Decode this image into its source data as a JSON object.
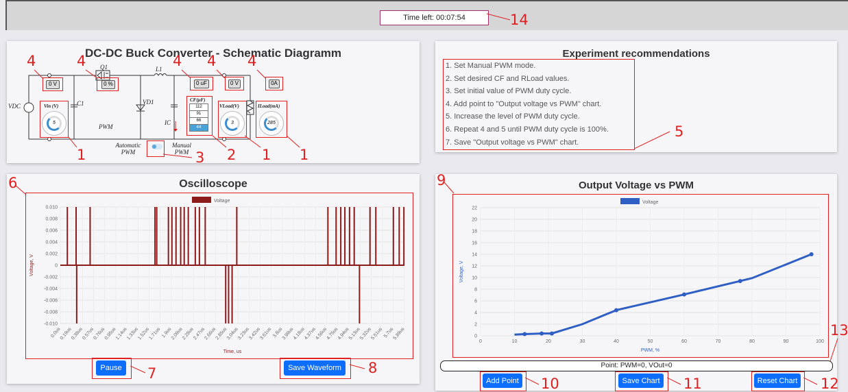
{
  "timer": {
    "text": "Time left: 00:07:54"
  },
  "annotations": {
    "a1": "1",
    "a2": "2",
    "a3": "3",
    "a4": "4",
    "a5": "5",
    "a6": "6",
    "a7": "7",
    "a8": "8",
    "a9": "9",
    "a10": "10",
    "a11": "11",
    "a12": "12",
    "a13": "13",
    "a14": "14"
  },
  "schematic": {
    "title": "DC-DC Buck Converter - Schematic Diagramm",
    "vdc": "VDC",
    "q1": "Q1",
    "l1": "L1",
    "c1": "C1",
    "vd1": "VD1",
    "pwm": "PWM",
    "ic": "IC",
    "vin_readout": "0 V",
    "pwm_readout": "0 %",
    "cf_readout": "0 uF",
    "vout_readout": "0 V",
    "iload_readout": "0A",
    "vin_knob_label": "Vin (V)",
    "vin_knob_value": "5",
    "vload_knob_label": "VLoad(V)",
    "vload_knob_value": "3",
    "iload_knob_label": "ILoad(mA)",
    "iload_knob_value": "285",
    "cf_label": "CF(μF)",
    "cf_options": [
      "112",
      "91",
      "66",
      "44"
    ],
    "cf_selected": "44",
    "auto_pwm": "Automatic PWM",
    "manual_pwm": "Manual PWM"
  },
  "recommendations": {
    "title": "Experiment recommendations",
    "items": [
      "1. Set Manual PWM mode.",
      "2. Set desired CF and RLoad values.",
      "3. Set initial value of PWM duty cycle.",
      "4. Add point to \"Output voltage vs PWM\" chart.",
      "5. Increase the level of PWM duty cycle.",
      "6. Repeat 4 and 5 until PWM duty cycle is 100%.",
      "7. Save \"Output voltage vs PWM\" chart."
    ]
  },
  "oscilloscope": {
    "title": "Oscilloscope",
    "pause_label": "Pause",
    "save_label": "Save Waveform"
  },
  "vpwm": {
    "title": "Output Voltage vs PWM",
    "point_text": "Point: PWM=0, VOut=0",
    "add_label": "Add Point",
    "save_label": "Save Chart",
    "reset_label": "Reset Chart"
  },
  "colors": {
    "osc_series": "#8b1a1a",
    "vpwm_series": "#2f5fc4",
    "button": "#0d6efd",
    "annotation": "#e02020"
  },
  "chart_data": [
    {
      "type": "line",
      "title": "",
      "legend": [
        "Voltage"
      ],
      "xlabel": "Time, us",
      "ylabel": "Voltage, V",
      "ylim": [
        -0.01,
        0.01
      ],
      "yticks": [
        "0.010",
        "0.008",
        "0.006",
        "0.004",
        "0.002",
        "0",
        "-0.002",
        "-0.004",
        "-0.006",
        "-0.008",
        "-0.010"
      ],
      "xticks": [
        "0.0us",
        "0.19us",
        "0.38us",
        "0.57us",
        "0.76us",
        "0.95us",
        "1.14us",
        "1.33us",
        "1.52us",
        "1.71us",
        "1.9us",
        "2.09us",
        "2.28us",
        "2.47us",
        "2.66us",
        "2.85us",
        "3.04us",
        "3.23us",
        "3.42us",
        "3.61us",
        "3.8us",
        "3.99us",
        "4.18us",
        "4.37us",
        "4.56us",
        "4.75us",
        "4.94us",
        "5.13us",
        "5.32us",
        "5.51us",
        "5.7us",
        "5.89us"
      ],
      "series": [
        {
          "name": "Voltage",
          "spikes": [
            {
              "t": 0.12,
              "v": 0.01
            },
            {
              "t": 0.27,
              "v": 0.01
            },
            {
              "t": 0.28,
              "v": -0.01
            },
            {
              "t": 0.51,
              "v": 0.01
            },
            {
              "t": 1.62,
              "v": 0.01
            },
            {
              "t": 1.65,
              "v": 0.01
            },
            {
              "t": 1.85,
              "v": 0.01
            },
            {
              "t": 1.91,
              "v": 0.01
            },
            {
              "t": 1.98,
              "v": 0.01
            },
            {
              "t": 2.06,
              "v": 0.01
            },
            {
              "t": 2.12,
              "v": 0.01
            },
            {
              "t": 2.19,
              "v": 0.01
            },
            {
              "t": 2.31,
              "v": 0.01
            },
            {
              "t": 2.38,
              "v": 0.01
            },
            {
              "t": 2.48,
              "v": 0.01
            },
            {
              "t": 2.83,
              "v": -0.01
            },
            {
              "t": 2.88,
              "v": -0.01
            },
            {
              "t": 2.94,
              "v": -0.01
            },
            {
              "t": 3.02,
              "v": 0.01
            },
            {
              "t": 4.58,
              "v": 0.01
            },
            {
              "t": 4.72,
              "v": 0.01
            },
            {
              "t": 4.8,
              "v": 0.01
            },
            {
              "t": 4.87,
              "v": 0.01
            },
            {
              "t": 4.95,
              "v": 0.01
            },
            {
              "t": 5.03,
              "v": 0.01
            },
            {
              "t": 5.12,
              "v": -0.01
            },
            {
              "t": 5.3,
              "v": 0.01
            },
            {
              "t": 5.4,
              "v": 0.01
            },
            {
              "t": 5.7,
              "v": 0.01
            },
            {
              "t": 5.8,
              "v": 0.01
            },
            {
              "t": 5.88,
              "v": 0.01
            }
          ]
        }
      ]
    },
    {
      "type": "line",
      "title": "Output Voltage vs PWM",
      "legend": [
        "Voltage"
      ],
      "xlabel": "PWM, %",
      "ylabel": "Voltage, V",
      "xlim": [
        0,
        100
      ],
      "ylim": [
        0,
        22
      ],
      "series": [
        {
          "name": "Voltage",
          "x": [
            10,
            13,
            18,
            21,
            30,
            40,
            60,
            76.5,
            80,
            97.5
          ],
          "y": [
            0.2,
            0.3,
            0.4,
            0.4,
            2.0,
            4.4,
            7.1,
            9.4,
            9.9,
            14.0
          ],
          "markers_at": [
            13,
            18,
            21,
            40,
            60,
            76.5,
            97.5
          ]
        }
      ]
    }
  ]
}
